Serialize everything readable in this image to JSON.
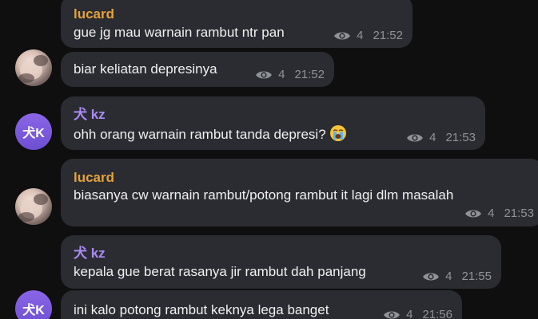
{
  "colors": {
    "lucard_name": "#e3a23c",
    "kz_name": "#a98bf5"
  },
  "messages": [
    {
      "sender": "lucard",
      "text": "gue jg mau warnain rambut ntr pan",
      "views": "4",
      "time": "21:52"
    },
    {
      "text": "biar keliatan depresinya",
      "views": "4",
      "time": "21:52"
    },
    {
      "sender": "犬 kz",
      "text": "ohh orang warnain rambut tanda depresi?",
      "emoji": "loudly-crying-face",
      "views": "4",
      "time": "21:53"
    },
    {
      "sender": "lucard",
      "text": "biasanya cw warnain rambut/potong rambut it lagi dlm masalah",
      "views": "4",
      "time": "21:53"
    },
    {
      "sender": "犬 kz",
      "text": "kepala gue berat rasanya jir rambut dah panjang",
      "views": "4",
      "time": "21:55"
    },
    {
      "text": "ini kalo potong rambut keknya lega banget",
      "views": "4",
      "time": "21:56"
    }
  ],
  "avatars": {
    "kz_initials": "犬K"
  }
}
